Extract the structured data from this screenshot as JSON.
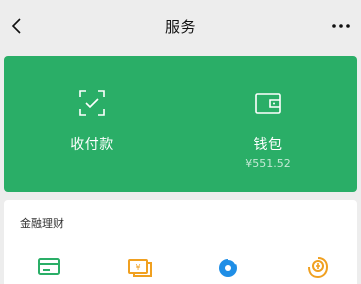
{
  "header": {
    "title": "服务",
    "back_icon": "chevron-left-icon",
    "more_icon": "more-dots-icon"
  },
  "card": {
    "color": "#2aae67",
    "items": [
      {
        "label": "收付款",
        "icon": "scan-check-icon"
      },
      {
        "label": "钱包",
        "balance": "¥551.52",
        "icon": "wallet-icon"
      }
    ]
  },
  "finance": {
    "title": "金融理财",
    "icons": [
      "credit-card-icon",
      "yuan-bill-icon",
      "blue-circle-icon",
      "gold-coin-icon"
    ],
    "colors": [
      "#2aae67",
      "#f0a020",
      "#1f8ee6",
      "#f0a020"
    ]
  }
}
